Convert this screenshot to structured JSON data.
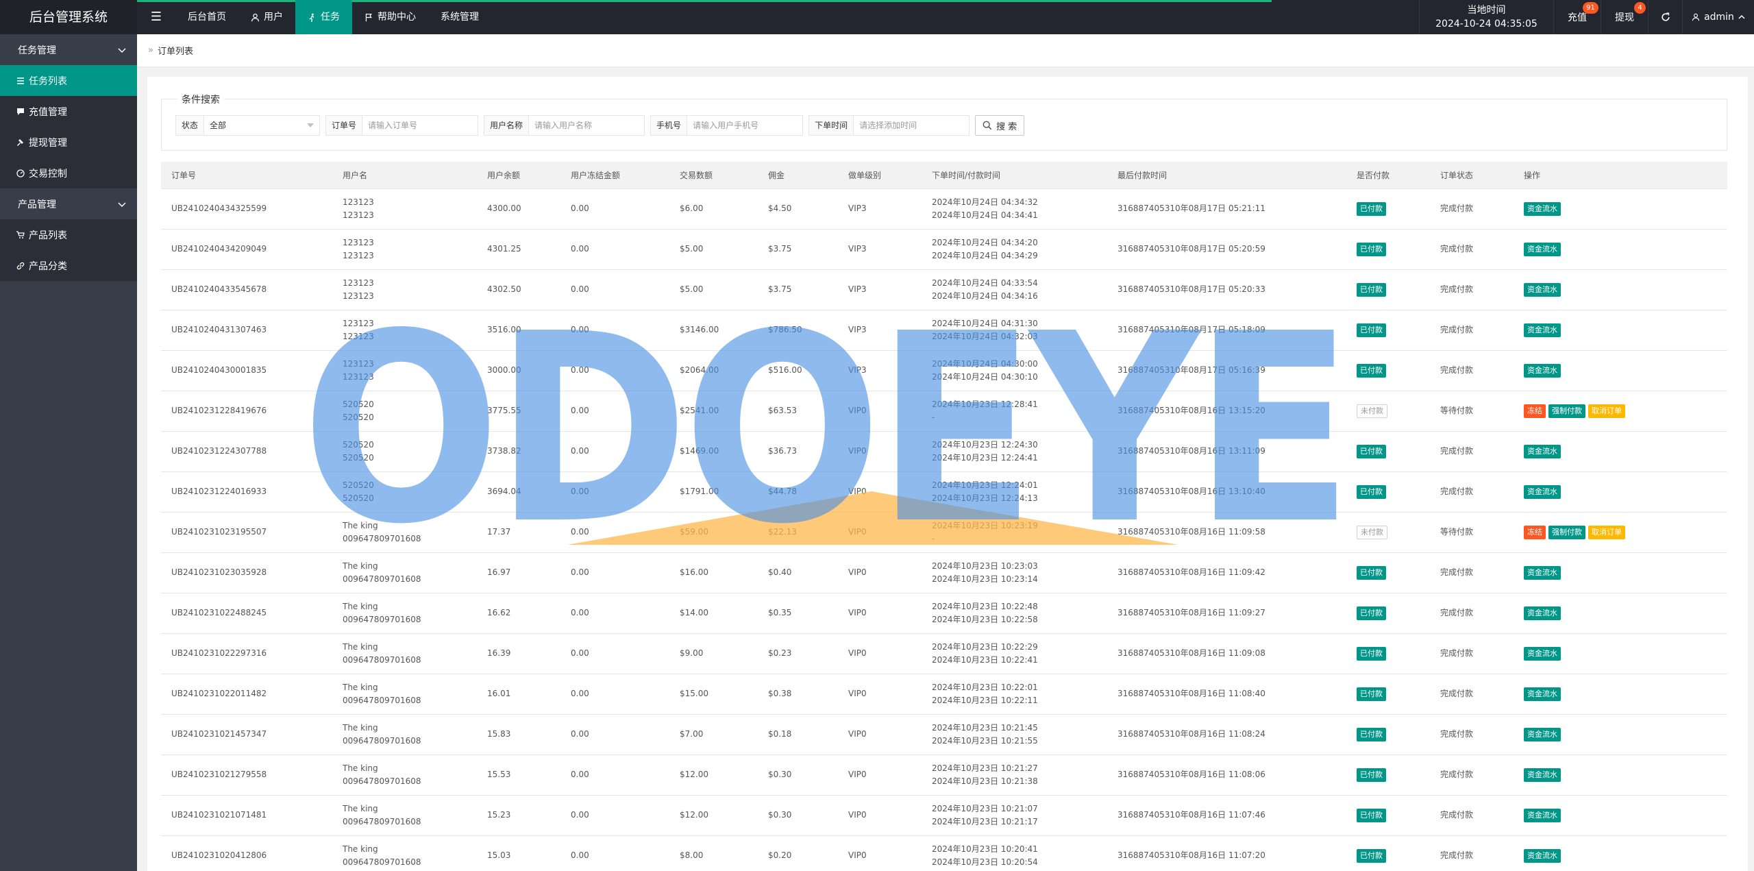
{
  "app": {
    "title": "后台管理系统"
  },
  "header": {
    "menu_icon": "hamburger-icon",
    "nav": [
      {
        "label": "后台首页",
        "icon": ""
      },
      {
        "label": "用户",
        "icon": "user-icon"
      },
      {
        "label": "任务",
        "icon": "walker-icon",
        "active": true
      },
      {
        "label": "帮助中心",
        "icon": "flag-icon"
      },
      {
        "label": "系统管理",
        "icon": ""
      }
    ],
    "clock_label": "当地时间",
    "clock_value": "2024-10-24 04:35:05",
    "recharge_label": "充值",
    "recharge_badge": "91",
    "withdraw_label": "提现",
    "withdraw_badge": "4",
    "user_label": "admin"
  },
  "sidebar": {
    "groups": [
      {
        "label": "任务管理",
        "items": [
          {
            "label": "任务列表",
            "icon": "list-icon",
            "active": true
          },
          {
            "label": "充值管理",
            "icon": "comment-icon"
          },
          {
            "label": "提现管理",
            "icon": "gavel-icon"
          },
          {
            "label": "交易控制",
            "icon": "dashboard-icon"
          }
        ]
      },
      {
        "label": "产品管理",
        "items": [
          {
            "label": "产品列表",
            "icon": "cart-icon"
          },
          {
            "label": "产品分类",
            "icon": "link-icon"
          }
        ]
      }
    ]
  },
  "breadcrumb": {
    "current": "订单列表"
  },
  "search": {
    "legend": "条件搜索",
    "status_label": "状态",
    "status_value": "全部",
    "order_label": "订单号",
    "order_placeholder": "请输入订单号",
    "username_label": "用户名称",
    "username_placeholder": "请输入用户名称",
    "phone_label": "手机号",
    "phone_placeholder": "请输入用户手机号",
    "time_label": "下单时间",
    "time_placeholder": "请选择添加时间",
    "button_label": "搜 索"
  },
  "table": {
    "columns": [
      "订单号",
      "用户名",
      "用户余额",
      "用户冻结金额",
      "交易数额",
      "佣金",
      "做单级别",
      "下单时间/付款时间",
      "最后付款时间",
      "是否付款",
      "订单状态",
      "操作"
    ],
    "rows": [
      {
        "order": "UB2410240434325599",
        "user1": "123123",
        "user2": "123123",
        "balance": "4300.00",
        "frozen": "0.00",
        "amount": "$6.00",
        "commission": "$4.50",
        "level": "VIP3",
        "time1": "2024年10月24日 04:34:32",
        "time2": "2024年10月24日 04:34:41",
        "last": "316887405310年08月17日 05:21:11",
        "paid": "已付款",
        "paid_style": "green",
        "status": "完成付款",
        "actions": [
          {
            "label": "资金流水",
            "style": "green"
          }
        ]
      },
      {
        "order": "UB2410240434209049",
        "user1": "123123",
        "user2": "123123",
        "balance": "4301.25",
        "frozen": "0.00",
        "amount": "$5.00",
        "commission": "$3.75",
        "level": "VIP3",
        "time1": "2024年10月24日 04:34:20",
        "time2": "2024年10月24日 04:34:29",
        "last": "316887405310年08月17日 05:20:59",
        "paid": "已付款",
        "paid_style": "green",
        "status": "完成付款",
        "actions": [
          {
            "label": "资金流水",
            "style": "green"
          }
        ]
      },
      {
        "order": "UB2410240433545678",
        "user1": "123123",
        "user2": "123123",
        "balance": "4302.50",
        "frozen": "0.00",
        "amount": "$5.00",
        "commission": "$3.75",
        "level": "VIP3",
        "time1": "2024年10月24日 04:33:54",
        "time2": "2024年10月24日 04:34:16",
        "last": "316887405310年08月17日 05:20:33",
        "paid": "已付款",
        "paid_style": "green",
        "status": "完成付款",
        "actions": [
          {
            "label": "资金流水",
            "style": "green"
          }
        ]
      },
      {
        "order": "UB2410240431307463",
        "user1": "123123",
        "user2": "123123",
        "balance": "3516.00",
        "frozen": "0.00",
        "amount": "$3146.00",
        "commission": "$786.50",
        "level": "VIP3",
        "time1": "2024年10月24日 04:31:30",
        "time2": "2024年10月24日 04:32:03",
        "last": "316887405310年08月17日 05:18:09",
        "paid": "已付款",
        "paid_style": "green",
        "status": "完成付款",
        "actions": [
          {
            "label": "资金流水",
            "style": "green"
          }
        ]
      },
      {
        "order": "UB2410240430001835",
        "user1": "123123",
        "user2": "123123",
        "balance": "3000.00",
        "frozen": "0.00",
        "amount": "$2064.00",
        "commission": "$516.00",
        "level": "VIP3",
        "time1": "2024年10月24日 04:30:00",
        "time2": "2024年10月24日 04:30:10",
        "last": "316887405310年08月17日 05:16:39",
        "paid": "已付款",
        "paid_style": "green",
        "status": "完成付款",
        "actions": [
          {
            "label": "资金流水",
            "style": "green"
          }
        ]
      },
      {
        "order": "UB2410231228419676",
        "user1": "520520",
        "user2": "520520",
        "balance": "3775.55",
        "frozen": "0.00",
        "amount": "$2541.00",
        "commission": "$63.53",
        "level": "VIP0",
        "time1": "2024年10月23日 12:28:41",
        "time2": "-",
        "last": "316887405310年08月16日 13:15:20",
        "paid": "未付款",
        "paid_style": "gray",
        "status": "等待付款",
        "actions": [
          {
            "label": "冻结",
            "style": "red"
          },
          {
            "label": "强制付款",
            "style": "green"
          },
          {
            "label": "取消订单",
            "style": "yellow"
          }
        ]
      },
      {
        "order": "UB2410231224307788",
        "user1": "520520",
        "user2": "520520",
        "balance": "3738.82",
        "frozen": "0.00",
        "amount": "$1469.00",
        "commission": "$36.73",
        "level": "VIP0",
        "time1": "2024年10月23日 12:24:30",
        "time2": "2024年10月23日 12:24:41",
        "last": "316887405310年08月16日 13:11:09",
        "paid": "已付款",
        "paid_style": "green",
        "status": "完成付款",
        "actions": [
          {
            "label": "资金流水",
            "style": "green"
          }
        ]
      },
      {
        "order": "UB2410231224016933",
        "user1": "520520",
        "user2": "520520",
        "balance": "3694.04",
        "frozen": "0.00",
        "amount": "$1791.00",
        "commission": "$44.78",
        "level": "VIP0",
        "time1": "2024年10月23日 12:24:01",
        "time2": "2024年10月23日 12:24:13",
        "last": "316887405310年08月16日 13:10:40",
        "paid": "已付款",
        "paid_style": "green",
        "status": "完成付款",
        "actions": [
          {
            "label": "资金流水",
            "style": "green"
          }
        ]
      },
      {
        "order": "UB2410231023195507",
        "user1": "The king",
        "user2": "009647809701608",
        "balance": "17.37",
        "frozen": "0.00",
        "amount": "$59.00",
        "commission": "$22.13",
        "level": "VIP0",
        "time1": "2024年10月23日 10:23:19",
        "time2": "-",
        "last": "316887405310年08月16日 11:09:58",
        "paid": "未付款",
        "paid_style": "gray",
        "status": "等待付款",
        "actions": [
          {
            "label": "冻结",
            "style": "red"
          },
          {
            "label": "强制付款",
            "style": "green"
          },
          {
            "label": "取消订单",
            "style": "yellow"
          }
        ]
      },
      {
        "order": "UB2410231023035928",
        "user1": "The king",
        "user2": "009647809701608",
        "balance": "16.97",
        "frozen": "0.00",
        "amount": "$16.00",
        "commission": "$0.40",
        "level": "VIP0",
        "time1": "2024年10月23日 10:23:03",
        "time2": "2024年10月23日 10:23:14",
        "last": "316887405310年08月16日 11:09:42",
        "paid": "已付款",
        "paid_style": "green",
        "status": "完成付款",
        "actions": [
          {
            "label": "资金流水",
            "style": "green"
          }
        ]
      },
      {
        "order": "UB2410231022488245",
        "user1": "The king",
        "user2": "009647809701608",
        "balance": "16.62",
        "frozen": "0.00",
        "amount": "$14.00",
        "commission": "$0.35",
        "level": "VIP0",
        "time1": "2024年10月23日 10:22:48",
        "time2": "2024年10月23日 10:22:58",
        "last": "316887405310年08月16日 11:09:27",
        "paid": "已付款",
        "paid_style": "green",
        "status": "完成付款",
        "actions": [
          {
            "label": "资金流水",
            "style": "green"
          }
        ]
      },
      {
        "order": "UB2410231022297316",
        "user1": "The king",
        "user2": "009647809701608",
        "balance": "16.39",
        "frozen": "0.00",
        "amount": "$9.00",
        "commission": "$0.23",
        "level": "VIP0",
        "time1": "2024年10月23日 10:22:29",
        "time2": "2024年10月23日 10:22:41",
        "last": "316887405310年08月16日 11:09:08",
        "paid": "已付款",
        "paid_style": "green",
        "status": "完成付款",
        "actions": [
          {
            "label": "资金流水",
            "style": "green"
          }
        ]
      },
      {
        "order": "UB2410231022011482",
        "user1": "The king",
        "user2": "009647809701608",
        "balance": "16.01",
        "frozen": "0.00",
        "amount": "$15.00",
        "commission": "$0.38",
        "level": "VIP0",
        "time1": "2024年10月23日 10:22:01",
        "time2": "2024年10月23日 10:22:11",
        "last": "316887405310年08月16日 11:08:40",
        "paid": "已付款",
        "paid_style": "green",
        "status": "完成付款",
        "actions": [
          {
            "label": "资金流水",
            "style": "green"
          }
        ]
      },
      {
        "order": "UB2410231021457347",
        "user1": "The king",
        "user2": "009647809701608",
        "balance": "15.83",
        "frozen": "0.00",
        "amount": "$7.00",
        "commission": "$0.18",
        "level": "VIP0",
        "time1": "2024年10月23日 10:21:45",
        "time2": "2024年10月23日 10:21:55",
        "last": "316887405310年08月16日 11:08:24",
        "paid": "已付款",
        "paid_style": "green",
        "status": "完成付款",
        "actions": [
          {
            "label": "资金流水",
            "style": "green"
          }
        ]
      },
      {
        "order": "UB2410231021279558",
        "user1": "The king",
        "user2": "009647809701608",
        "balance": "15.53",
        "frozen": "0.00",
        "amount": "$12.00",
        "commission": "$0.30",
        "level": "VIP0",
        "time1": "2024年10月23日 10:21:27",
        "time2": "2024年10月23日 10:21:38",
        "last": "316887405310年08月16日 11:08:06",
        "paid": "已付款",
        "paid_style": "green",
        "status": "完成付款",
        "actions": [
          {
            "label": "资金流水",
            "style": "green"
          }
        ]
      },
      {
        "order": "UB2410231021071481",
        "user1": "The king",
        "user2": "009647809701608",
        "balance": "15.23",
        "frozen": "0.00",
        "amount": "$12.00",
        "commission": "$0.30",
        "level": "VIP0",
        "time1": "2024年10月23日 10:21:07",
        "time2": "2024年10月23日 10:21:17",
        "last": "316887405310年08月16日 11:07:46",
        "paid": "已付款",
        "paid_style": "green",
        "status": "完成付款",
        "actions": [
          {
            "label": "资金流水",
            "style": "green"
          }
        ]
      },
      {
        "order": "UB2410231020412806",
        "user1": "The king",
        "user2": "009647809701608",
        "balance": "15.03",
        "frozen": "0.00",
        "amount": "$8.00",
        "commission": "$0.20",
        "level": "VIP0",
        "time1": "2024年10月23日 10:20:41",
        "time2": "2024年10月23日 10:20:54",
        "last": "316887405310年08月16日 11:07:20",
        "paid": "已付款",
        "paid_style": "green",
        "status": "完成付款",
        "actions": [
          {
            "label": "资金流水",
            "style": "green"
          }
        ]
      }
    ]
  },
  "watermark": {
    "text": "ODOEYE",
    "color": "#4a90e2",
    "triangle_color": "#ffb74d"
  },
  "colors": {
    "primary": "#009688",
    "danger": "#ff5722",
    "warning": "#ffb800",
    "header_bg": "#23262e",
    "sidebar_bg": "#393d49"
  }
}
